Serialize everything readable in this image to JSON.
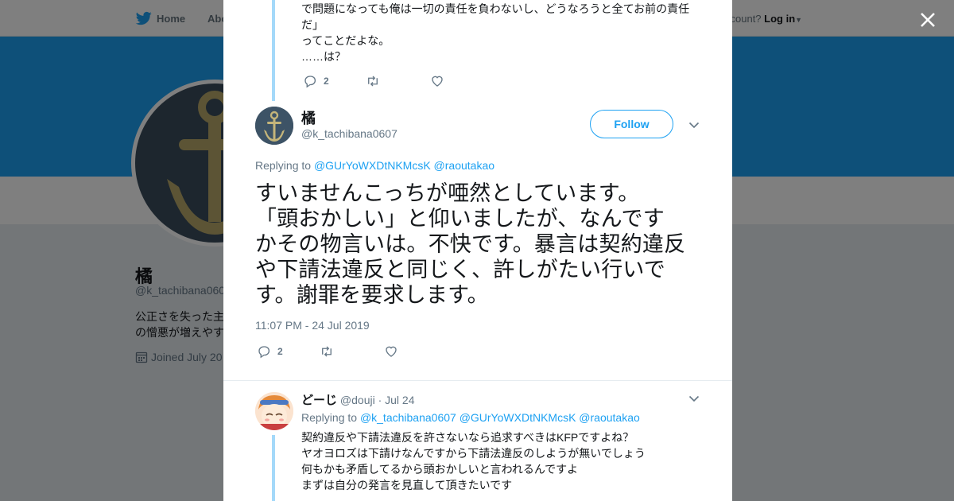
{
  "background": {
    "nav": {
      "home": "Home",
      "about": "Abo",
      "account_prompt": "ccount?",
      "login": "Log in"
    },
    "profile": {
      "name": "橘",
      "handle": "@k_tachibana060",
      "bio_lines": [
        "公正さを失った主",
        "の憎悪が増えやす"
      ],
      "joined": "Joined July 20"
    }
  },
  "previous_tweet": {
    "lines": [
      "で問題になっても俺は一切の責任を負わないし、どうなろうと全てお前の責任",
      "だ」",
      "ってことだよな。",
      "……は？"
    ],
    "reply_count": "2"
  },
  "main_tweet": {
    "name": "橘",
    "handle": "@k_tachibana0607",
    "follow_label": "Follow",
    "replying_prefix": "Replying to",
    "mentions": [
      "@GUrYoWXDtNKMcsK",
      "@raoutakao"
    ],
    "text_lines": [
      "すいませんこっちが唖然としています。",
      "「頭おかしい」と仰いましたが、なんです",
      "かその物言いは。不快です。暴言は契約違反",
      "や下請法違反と同じく、許しがたい行いで",
      "す。謝罪を要求します。"
    ],
    "timestamp": "11:07 PM - 24 Jul 2019",
    "reply_count": "2"
  },
  "reply_tweet": {
    "name": "どーじ",
    "handle": "@douji",
    "date": "· Jul 24",
    "replying_prefix": "Replying to",
    "mentions": [
      "@k_tachibana0607",
      "@GUrYoWXDtNKMcsK",
      "@raoutakao"
    ],
    "text_lines": [
      "契約違反や下請法違反を許さないなら追求すべきはKFPですよね？",
      "ヤオヨロズは下請けなんですから下請法違反のしようが無いでしょう",
      "何もかも矛盾してるから頭おかしいと言われるんですよ",
      "まずは自分の発言を見直して頂きたいです"
    ]
  },
  "colors": {
    "accent": "#1da1f2",
    "thread_line": "#a4d9f9",
    "text": "#14171a",
    "muted": "#657786"
  }
}
